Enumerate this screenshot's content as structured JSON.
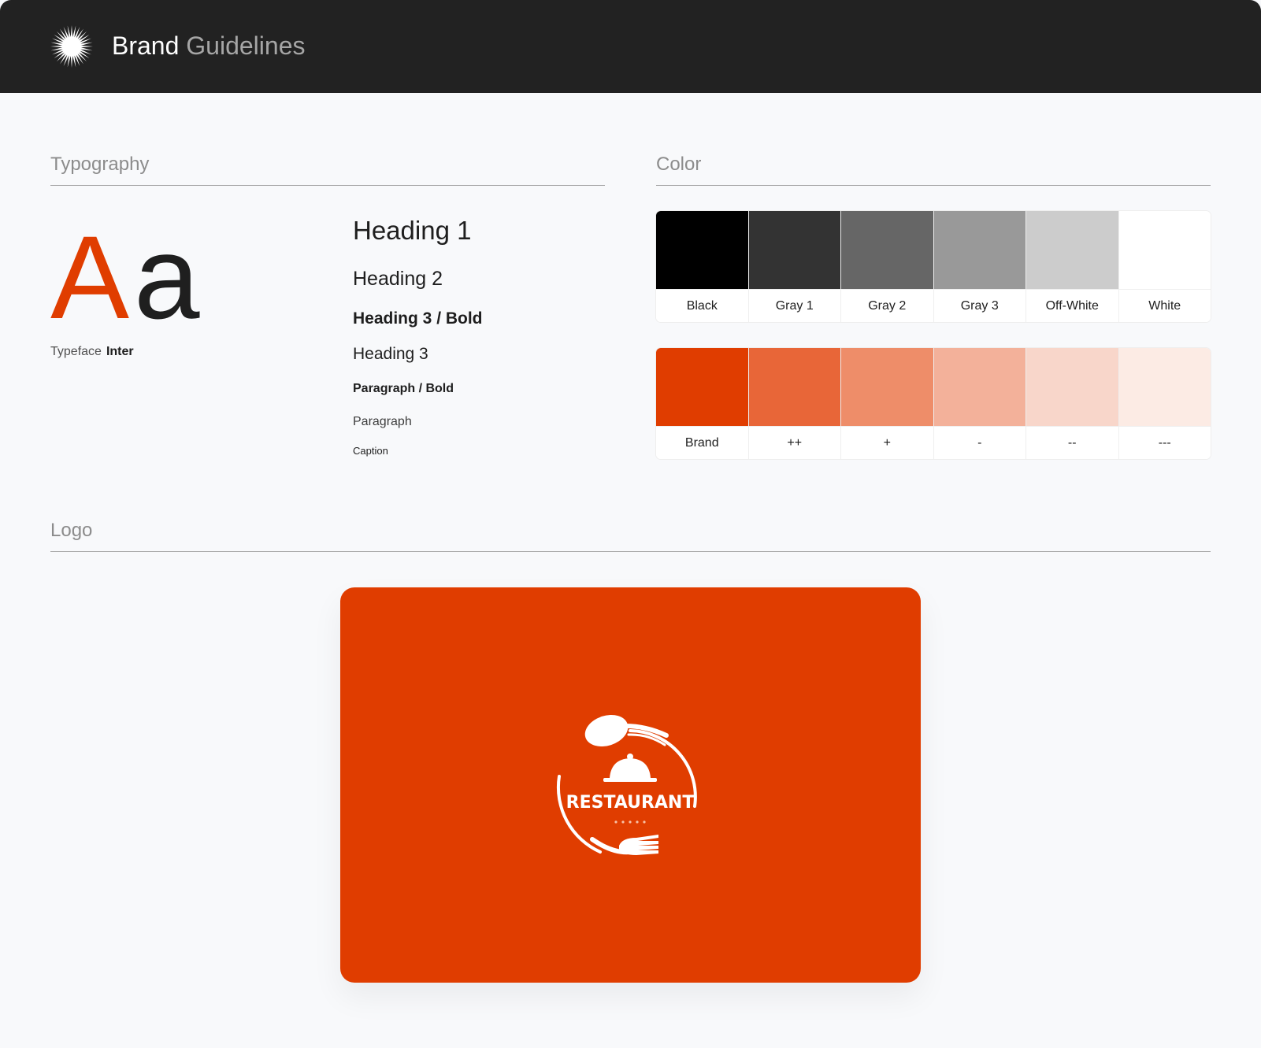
{
  "header": {
    "title_primary": "Brand",
    "title_secondary": "Guidelines",
    "logo_icon": "starburst-icon"
  },
  "typography": {
    "section_title": "Typography",
    "specimen_upper": "A",
    "specimen_lower": "a",
    "typeface_label": "Typeface",
    "typeface_name": "Inter",
    "samples": [
      {
        "label": "Heading 1"
      },
      {
        "label": "Heading 2"
      },
      {
        "label": "Heading 3 / Bold"
      },
      {
        "label": "Heading 3"
      },
      {
        "label": "Paragraph / Bold"
      },
      {
        "label": "Paragraph"
      },
      {
        "label": "Caption"
      }
    ]
  },
  "color": {
    "section_title": "Color",
    "neutrals": [
      {
        "name": "Black",
        "hex": "#000000"
      },
      {
        "name": "Gray 1",
        "hex": "#333333"
      },
      {
        "name": "Gray 2",
        "hex": "#666666"
      },
      {
        "name": "Gray 3",
        "hex": "#999999"
      },
      {
        "name": "Off-White",
        "hex": "#cccccc"
      },
      {
        "name": "White",
        "hex": "#ffffff"
      }
    ],
    "brand": [
      {
        "name": "Brand",
        "hex": "#e03d00"
      },
      {
        "name": "++",
        "hex": "#e86638"
      },
      {
        "name": "+",
        "hex": "#ee8d69"
      },
      {
        "name": "-",
        "hex": "#f3b19a"
      },
      {
        "name": "--",
        "hex": "#f8d6ca"
      },
      {
        "name": "---",
        "hex": "#fcebe4"
      }
    ]
  },
  "logo": {
    "section_title": "Logo",
    "wordmark": "RESTAURANT",
    "background": "#e03d00",
    "icon": "restaurant-cloche-logo"
  }
}
